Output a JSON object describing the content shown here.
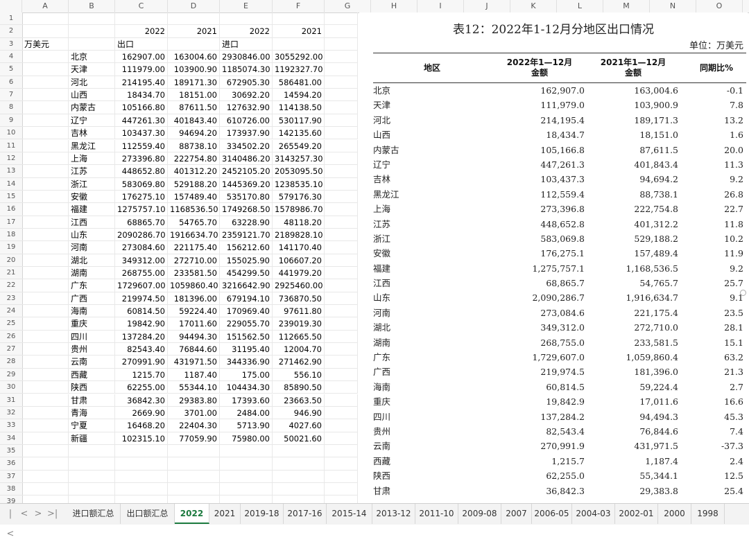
{
  "columns": [
    "A",
    "B",
    "C",
    "D",
    "E",
    "F",
    "G",
    "H",
    "I",
    "J",
    "K",
    "L",
    "M",
    "N",
    "O"
  ],
  "rows_numbers": [
    "1",
    "2",
    "3",
    "4",
    "5",
    "6",
    "7",
    "8",
    "9",
    "10",
    "11",
    "12",
    "13",
    "14",
    "15",
    "16",
    "17",
    "18",
    "19",
    "20",
    "21",
    "22",
    "23",
    "24",
    "25",
    "26",
    "27",
    "28",
    "29",
    "30",
    "31",
    "32",
    "33",
    "34",
    "35",
    "36",
    "37",
    "38",
    "39"
  ],
  "sheet": {
    "row2": {
      "c": "2022",
      "d": "2021",
      "e": "2022",
      "f": "2021"
    },
    "row3": {
      "a": "万美元",
      "c": "出口",
      "e": "进口"
    },
    "data": [
      [
        "北京",
        "162907.00",
        "163004.60",
        "2930846.00",
        "3055292.00"
      ],
      [
        "天津",
        "111979.00",
        "103900.90",
        "1185074.30",
        "1192327.70"
      ],
      [
        "河北",
        "214195.40",
        "189171.30",
        "672905.30",
        "586481.00"
      ],
      [
        "山西",
        "18434.70",
        "18151.00",
        "30692.20",
        "14594.20"
      ],
      [
        "内蒙古",
        "105166.80",
        "87611.50",
        "127632.90",
        "114138.50"
      ],
      [
        "辽宁",
        "447261.30",
        "401843.40",
        "610726.00",
        "530117.90"
      ],
      [
        "吉林",
        "103437.30",
        "94694.20",
        "173937.90",
        "142135.60"
      ],
      [
        "黑龙江",
        "112559.40",
        "88738.10",
        "334502.20",
        "265549.20"
      ],
      [
        "上海",
        "273396.80",
        "222754.80",
        "3140486.20",
        "3143257.30"
      ],
      [
        "江苏",
        "448652.80",
        "401312.20",
        "2452105.20",
        "2053095.50"
      ],
      [
        "浙江",
        "583069.80",
        "529188.20",
        "1445369.20",
        "1238535.10"
      ],
      [
        "安徽",
        "176275.10",
        "157489.40",
        "535170.80",
        "579176.30"
      ],
      [
        "福建",
        "1275757.10",
        "1168536.50",
        "1749268.50",
        "1578986.70"
      ],
      [
        "江西",
        "68865.70",
        "54765.70",
        "63228.90",
        "48118.20"
      ],
      [
        "山东",
        "2090286.70",
        "1916634.70",
        "2359121.70",
        "2189828.10"
      ],
      [
        "河南",
        "273084.60",
        "221175.40",
        "156212.60",
        "141170.40"
      ],
      [
        "湖北",
        "349312.00",
        "272710.00",
        "155025.90",
        "106607.20"
      ],
      [
        "湖南",
        "268755.00",
        "233581.50",
        "454299.50",
        "441979.20"
      ],
      [
        "广东",
        "1729607.00",
        "1059860.40",
        "3216642.90",
        "2925460.00"
      ],
      [
        "广西",
        "219974.50",
        "181396.00",
        "679194.10",
        "736870.50"
      ],
      [
        "海南",
        "60814.50",
        "59224.40",
        "170969.40",
        "97611.80"
      ],
      [
        "重庆",
        "19842.90",
        "17011.60",
        "229055.70",
        "239019.30"
      ],
      [
        "四川",
        "137284.20",
        "94494.30",
        "151562.50",
        "112665.50"
      ],
      [
        "贵州",
        "82543.40",
        "76844.60",
        "31195.40",
        "12004.70"
      ],
      [
        "云南",
        "270991.90",
        "431971.50",
        "344336.90",
        "271462.90"
      ],
      [
        "西藏",
        "1215.70",
        "1187.40",
        "175.00",
        "556.10"
      ],
      [
        "陕西",
        "62255.00",
        "55344.10",
        "104434.30",
        "85890.50"
      ],
      [
        "甘肃",
        "36842.30",
        "29383.80",
        "17393.60",
        "23663.50"
      ],
      [
        "青海",
        "2669.90",
        "3701.00",
        "2484.00",
        "946.90"
      ],
      [
        "宁夏",
        "16468.20",
        "22404.30",
        "5713.90",
        "4027.60"
      ],
      [
        "新疆",
        "102315.10",
        "77059.90",
        "75980.00",
        "50021.60"
      ]
    ]
  },
  "doc": {
    "title": "表12：2022年1-12月分地区出口情况",
    "unit": "单位：万美元",
    "headers": {
      "region": "地区",
      "y2022_line1": "2022年1—12月",
      "y2022_line2": "金额",
      "y2021_line1": "2021年1—12月",
      "y2021_line2": "金额",
      "yoy": "同期比%"
    },
    "rows": [
      [
        "北京",
        "162,907.0",
        "163,004.6",
        "-0.1"
      ],
      [
        "天津",
        "111,979.0",
        "103,900.9",
        "7.8"
      ],
      [
        "河北",
        "214,195.4",
        "189,171.3",
        "13.2"
      ],
      [
        "山西",
        "18,434.7",
        "18,151.0",
        "1.6"
      ],
      [
        "内蒙古",
        "105,166.8",
        "87,611.5",
        "20.0"
      ],
      [
        "辽宁",
        "447,261.3",
        "401,843.4",
        "11.3"
      ],
      [
        "吉林",
        "103,437.3",
        "94,694.2",
        "9.2"
      ],
      [
        "黑龙江",
        "112,559.4",
        "88,738.1",
        "26.8"
      ],
      [
        "上海",
        "273,396.8",
        "222,754.8",
        "22.7"
      ],
      [
        "江苏",
        "448,652.8",
        "401,312.2",
        "11.8"
      ],
      [
        "浙江",
        "583,069.8",
        "529,188.2",
        "10.2"
      ],
      [
        "安徽",
        "176,275.1",
        "157,489.4",
        "11.9"
      ],
      [
        "福建",
        "1,275,757.1",
        "1,168,536.5",
        "9.2"
      ],
      [
        "江西",
        "68,865.7",
        "54,765.7",
        "25.7"
      ],
      [
        "山东",
        "2,090,286.7",
        "1,916,634.7",
        "9.1"
      ],
      [
        "河南",
        "273,084.6",
        "221,175.4",
        "23.5"
      ],
      [
        "湖北",
        "349,312.0",
        "272,710.0",
        "28.1"
      ],
      [
        "湖南",
        "268,755.0",
        "233,581.5",
        "15.1"
      ],
      [
        "广东",
        "1,729,607.0",
        "1,059,860.4",
        "63.2"
      ],
      [
        "广西",
        "219,974.5",
        "181,396.0",
        "21.3"
      ],
      [
        "海南",
        "60,814.5",
        "59,224.4",
        "2.7"
      ],
      [
        "重庆",
        "19,842.9",
        "17,011.6",
        "16.6"
      ],
      [
        "四川",
        "137,284.2",
        "94,494.3",
        "45.3"
      ],
      [
        "贵州",
        "82,543.4",
        "76,844.6",
        "7.4"
      ],
      [
        "云南",
        "270,991.9",
        "431,971.5",
        "-37.3"
      ],
      [
        "西藏",
        "1,215.7",
        "1,187.4",
        "2.4"
      ],
      [
        "陕西",
        "62,255.0",
        "55,344.1",
        "12.5"
      ],
      [
        "甘肃",
        "36,842.3",
        "29,383.8",
        "25.4"
      ]
    ]
  },
  "tabs": [
    "进口额汇总",
    "出口额汇总",
    "2022",
    "2021",
    "2019-18",
    "2017-16",
    "2015-14",
    "2013-12",
    "2011-10",
    "2009-08",
    "2007",
    "2006-05",
    "2004-03",
    "2002-01",
    "2000",
    "1998"
  ],
  "active_tab": "2022",
  "nav": {
    "first": "|<",
    "prev": "<",
    "next": ">",
    "last": ">|"
  },
  "colors": {
    "active_tab": "#1b7a3e"
  }
}
